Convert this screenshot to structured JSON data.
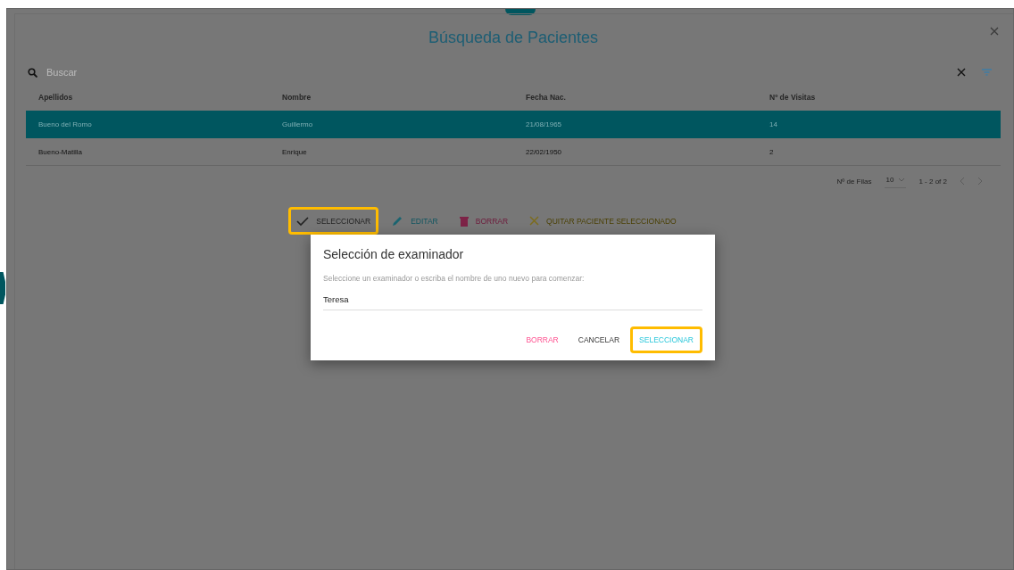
{
  "panel": {
    "title": "Búsqueda de Pacientes"
  },
  "search": {
    "placeholder": "Buscar"
  },
  "table": {
    "columns": [
      "Apellidos",
      "Nombre",
      "Fecha Nac.",
      "Nº de Visitas"
    ],
    "rows": [
      {
        "cells": [
          "Bueno del Romo",
          "Guillermo",
          "21/08/1965",
          "14"
        ],
        "selected": true
      },
      {
        "cells": [
          "Bueno-Matilla",
          "Enrique",
          "22/02/1950",
          "2"
        ],
        "selected": false
      }
    ]
  },
  "paginator": {
    "rows_label": "Nº de Filas",
    "rows_value": "10",
    "range": "1 - 2 of 2"
  },
  "actions": [
    {
      "kind": "select",
      "label": "SELECCIONAR",
      "highlighted": true
    },
    {
      "kind": "edit",
      "label": "EDITAR",
      "highlighted": false
    },
    {
      "kind": "delete",
      "label": "BORRAR",
      "highlighted": false
    },
    {
      "kind": "clear",
      "label": "QUITAR PACIENTE SELECCIONADO",
      "highlighted": false
    }
  ],
  "dialog": {
    "title": "Selección de examinador",
    "message": "Seleccione un examinador o escriba el nombre de uno nuevo para comenzar:",
    "value": "Teresa",
    "buttons": [
      {
        "kind": "delete",
        "label": "BORRAR",
        "highlighted": false
      },
      {
        "kind": "cancel",
        "label": "CANCELAR",
        "highlighted": false
      },
      {
        "kind": "confirm",
        "label": "SELECCIONAR",
        "highlighted": true
      }
    ]
  }
}
